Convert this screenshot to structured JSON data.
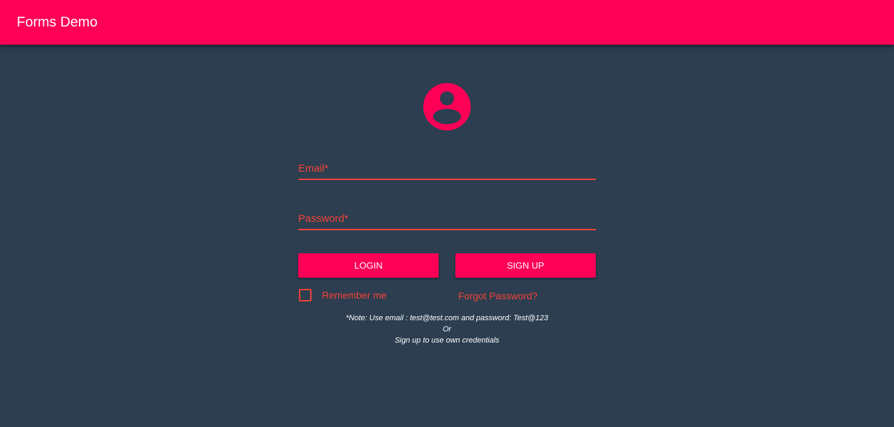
{
  "app": {
    "title": "Forms Demo"
  },
  "colors": {
    "accent": "#ff0057",
    "error": "#f44336",
    "background": "#2c3e50"
  },
  "avatar": {
    "icon": "account-circle-icon"
  },
  "form": {
    "email": {
      "label": "Email",
      "required_marker": "*",
      "value": ""
    },
    "password": {
      "label": "Password",
      "required_marker": "*",
      "value": ""
    },
    "login_label": "LOGIN",
    "signup_label": "SIGN UP",
    "remember_label": "Remember me",
    "remember_checked": false,
    "forgot_label": "Forgot Password?"
  },
  "note": {
    "line1": "*Note: Use email : test@test.com and password: Test@123",
    "line2": "Or",
    "line3": "Sign up to use own credentials"
  }
}
